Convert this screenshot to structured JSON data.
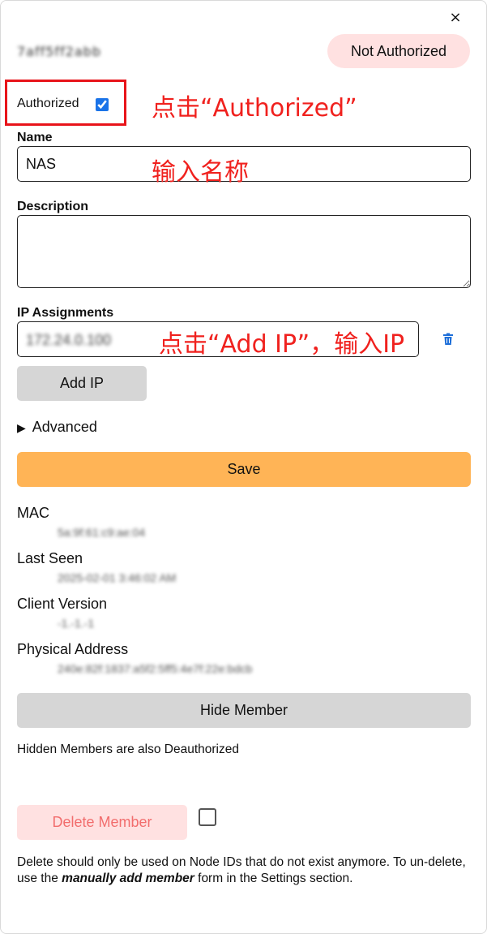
{
  "dialog": {
    "close_label": "×",
    "node_id": "7aff5ff2abb",
    "status_label": "Not Authorized"
  },
  "authorized": {
    "label": "Authorized",
    "checked": true
  },
  "annotations": {
    "click_authorized": "点击“Authorized”",
    "enter_name": "输入名称",
    "add_ip": "点击“Add IP”，输入IP"
  },
  "name_field": {
    "label": "Name",
    "value": "NAS"
  },
  "description_field": {
    "label": "Description",
    "value": ""
  },
  "ip_assignments": {
    "label": "IP Assignments",
    "value": "172.24.0.100",
    "add_button_label": "Add IP"
  },
  "advanced": {
    "label": "Advanced"
  },
  "save_button_label": "Save",
  "info": {
    "mac_label": "MAC",
    "mac_value": "5a:9f:61:c9:ae:04",
    "last_seen_label": "Last Seen",
    "last_seen_value": "2025-02-01 3:46:02 AM",
    "client_version_label": "Client Version",
    "client_version_value": "-1.-1.-1",
    "physical_address_label": "Physical Address",
    "physical_address_value": "240e:82f:1837:a5f2:5ff5:4e7f:22e:bdcb"
  },
  "hide_member": {
    "button_label": "Hide Member",
    "note": "Hidden Members are also Deauthorized"
  },
  "delete_member": {
    "button_label": "Delete Member",
    "note_prefix": "Delete should only be used on Node IDs that do not exist anymore. To un-delete, use the ",
    "note_emphasis": "manually add member",
    "note_suffix": " form in the Settings section."
  },
  "colors": {
    "annotation_red": "#f0211e",
    "save_orange": "#ffb456",
    "status_pill_bg": "#ffe1e1",
    "delete_text": "#f26d6d",
    "checkbox_blue": "#1a73e8",
    "trash_blue": "#1e6fd9"
  },
  "icons": {
    "close": "close-icon",
    "trash": "trash-icon",
    "advanced_toggle": "triangle-right-icon"
  }
}
